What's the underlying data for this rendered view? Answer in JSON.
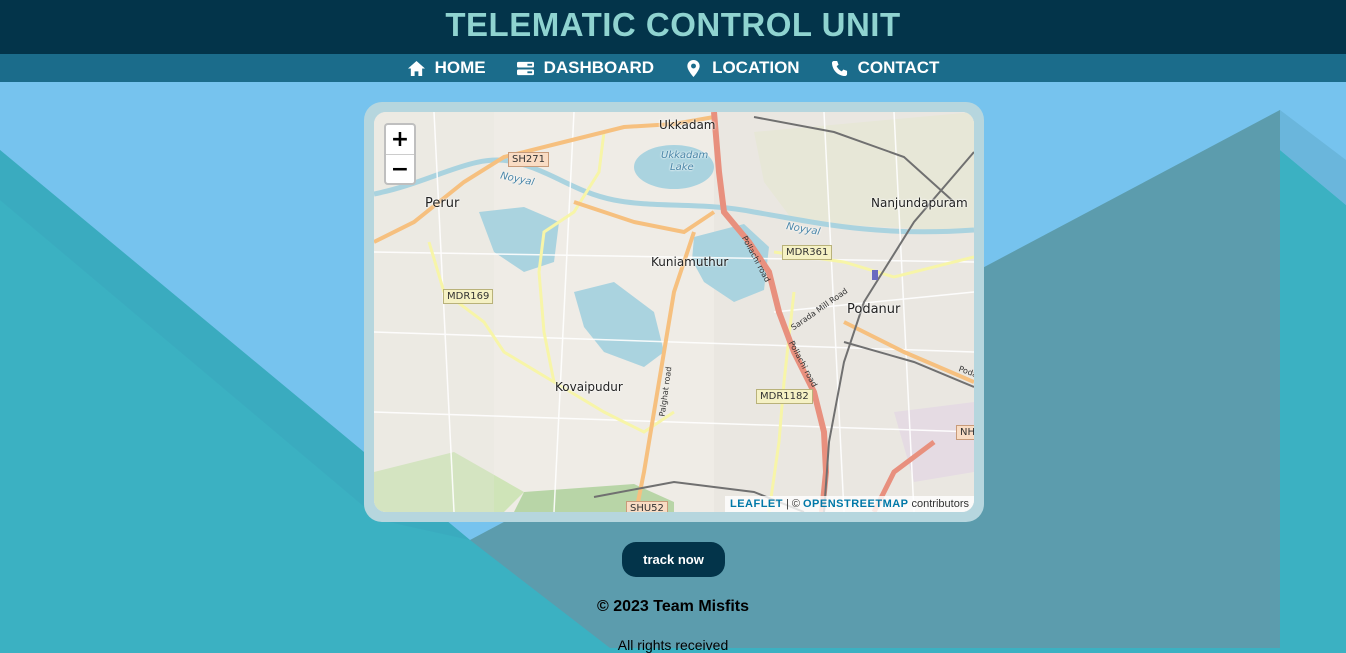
{
  "header": {
    "title": "TELEMATIC CONTROL UNIT"
  },
  "nav": {
    "items": [
      {
        "label": "HOME",
        "icon": "home-icon"
      },
      {
        "label": "DASHBOARD",
        "icon": "dashboard-icon"
      },
      {
        "label": "LOCATION",
        "icon": "map-pin-icon"
      },
      {
        "label": "CONTACT",
        "icon": "phone-icon"
      }
    ]
  },
  "map": {
    "zoom_in": "+",
    "zoom_out": "−",
    "attribution": {
      "leaflet": "LEAFLET",
      "separator": "| ©",
      "osm": "OPENSTREETMAP",
      "suffix": "contributors"
    },
    "places": {
      "ukkadam": "Ukkadam",
      "ukkadam_lake_1": "Ukkadam",
      "ukkadam_lake_2": "Lake",
      "perur": "Perur",
      "nanjundapuram": "Nanjundapuram",
      "kuniamuthur": "Kuniamuthur",
      "podanur": "Podanur",
      "kovaipudur": "Kovaipudur",
      "noyyal_1": "Noyyal",
      "noyyal_2": "Noyyal"
    },
    "roads": {
      "sh271": "SH271",
      "mdr361": "MDR361",
      "mdr169": "MDR169",
      "mdr1182": "MDR1182",
      "shu52": "SHU52",
      "nh": "NH",
      "pollachi_1": "Pollachi road",
      "pollachi_2": "Pollachi road",
      "palghat": "Palghat road",
      "sarada": "Sarada Mill Road",
      "poda": "Poda"
    }
  },
  "actions": {
    "track_label": "track now"
  },
  "footer": {
    "copyright": "© 2023 Team Misfits",
    "rights": "All rights received"
  },
  "colors": {
    "header_bg": "#03344a",
    "title_color": "#8fd3d0",
    "nav_bg": "#1b6c8b",
    "bg_light_blue": "#76c3ee",
    "bg_teal": "#3bb1c2",
    "bg_slate": "#5c9cad"
  }
}
